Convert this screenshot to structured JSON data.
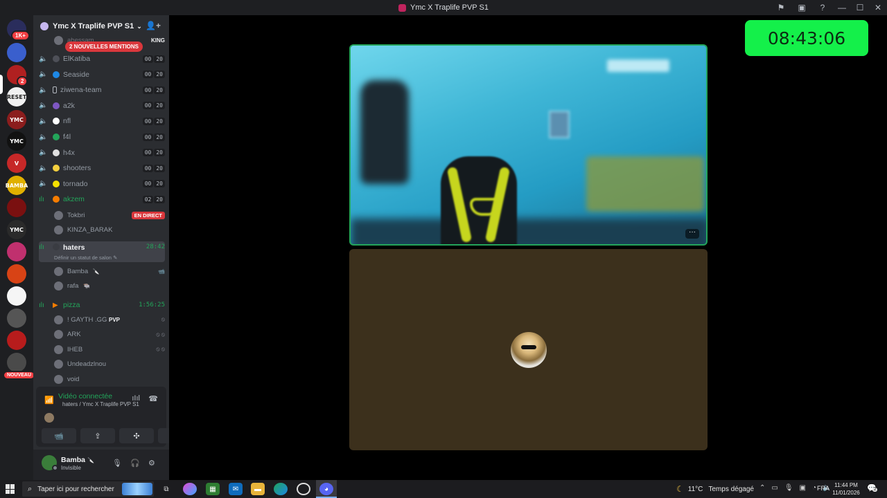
{
  "window": {
    "title": "Ymc X Traplife PVP S1",
    "controls": [
      "⚑",
      "▣",
      "?"
    ]
  },
  "servers": {
    "items": [
      {
        "label": "",
        "color": "#2a2d5c",
        "badge": "1K+"
      },
      {
        "label": "",
        "color": "#3a5fcd"
      },
      {
        "label": "",
        "color": "#b02020",
        "badge": "2"
      },
      {
        "label": "RESET",
        "color": "#f1f1f1"
      },
      {
        "label": "YMC",
        "color": "#8b1d1d"
      },
      {
        "label": "YMC",
        "color": "#111111"
      },
      {
        "label": "V",
        "color": "#c62828"
      },
      {
        "label": "BAMBA",
        "color": "#e0b000"
      },
      {
        "label": "",
        "color": "#7a1010"
      },
      {
        "label": "YMC",
        "color": "#2a2a2a"
      },
      {
        "label": "",
        "color": "#c0306e"
      },
      {
        "label": "",
        "color": "#d84315"
      },
      {
        "label": "",
        "color": "#f5f5f5"
      },
      {
        "label": "",
        "color": "#555555"
      },
      {
        "label": "",
        "color": "#b71c1c"
      },
      {
        "label": "",
        "color": "#4a4a4a"
      }
    ],
    "new_badge": "NOUVEAU"
  },
  "guild": {
    "name": "Ymc X Traplife PVP S1",
    "mentions": "2 NOUVELLES MENTIONS",
    "partial_user": "abessam",
    "partial_tag": "KING"
  },
  "voice_channels": [
    {
      "name": "ElKatiba",
      "dot": "#4e5058",
      "c1": "00",
      "c2": "20"
    },
    {
      "name": "Seaside",
      "dot": "#1e88e5",
      "c1": "00",
      "c2": "20"
    },
    {
      "name": "ziwena-team",
      "dot": "#2b2d31",
      "c1": "00",
      "c2": "20"
    },
    {
      "name": "a2k",
      "dot": "#7e57c2",
      "c1": "00",
      "c2": "20"
    },
    {
      "name": "nfl",
      "dot": "#ffffff",
      "c1": "00",
      "c2": "20"
    },
    {
      "name": "f4l",
      "dot": "#23a55a",
      "c1": "00",
      "c2": "20"
    },
    {
      "name": "h4x",
      "dot": "#e0e0e0",
      "c1": "00",
      "c2": "20"
    },
    {
      "name": "shooters",
      "dot": "#f4d03f",
      "c1": "00",
      "c2": "20"
    },
    {
      "name": "tornado",
      "dot": "#f5e100",
      "c1": "00",
      "c2": "20"
    },
    {
      "name": "akzem",
      "dot": "#f57c00",
      "c1": "02",
      "c2": "20"
    }
  ],
  "akzem_users": [
    {
      "name": "Tokbri",
      "live": "EN DIRECT"
    },
    {
      "name": "KINZA_BARAK",
      "live": ""
    }
  ],
  "haters": {
    "name": "haters",
    "time": "28:42",
    "status_hint": "Définir un statut de salon",
    "users": [
      {
        "name": "Bamba",
        "tag": "🔪",
        "extra": "📹"
      },
      {
        "name": "rafa",
        "tag": "🐃",
        "extra": ""
      }
    ]
  },
  "pizza": {
    "name": "pizza",
    "time": "1:56:25",
    "users": [
      {
        "name": "! GAYTH .GG",
        "tag": "PVP",
        "extra": "⦸"
      },
      {
        "name": "ARK",
        "tag": "",
        "extra": "⦸ ⦸"
      },
      {
        "name": "IHEB",
        "tag": "",
        "extra": "⦸ ⦸"
      },
      {
        "name": "Undeadzlnou",
        "tag": "",
        "extra": ""
      },
      {
        "name": "void",
        "tag": "",
        "extra": ""
      }
    ]
  },
  "voice_panel": {
    "status": "Vidéo connectée",
    "location": "haters / Ymc X Traplife PVP S1",
    "buttons": [
      "📹",
      "⇪",
      "✣",
      "✨"
    ]
  },
  "user": {
    "name": "Bamba",
    "tag": "🔪",
    "status": "Invisible"
  },
  "stage": {
    "clock": "08:43:06",
    "more": "···"
  },
  "taskbar": {
    "search_placeholder": "Taper ici pour rechercher",
    "weather_temp": "11°C",
    "weather_desc": "Temps dégagé",
    "lang": "FRA",
    "time": "11:44 PM",
    "date": "11/01/2026",
    "notif_count": "2"
  }
}
